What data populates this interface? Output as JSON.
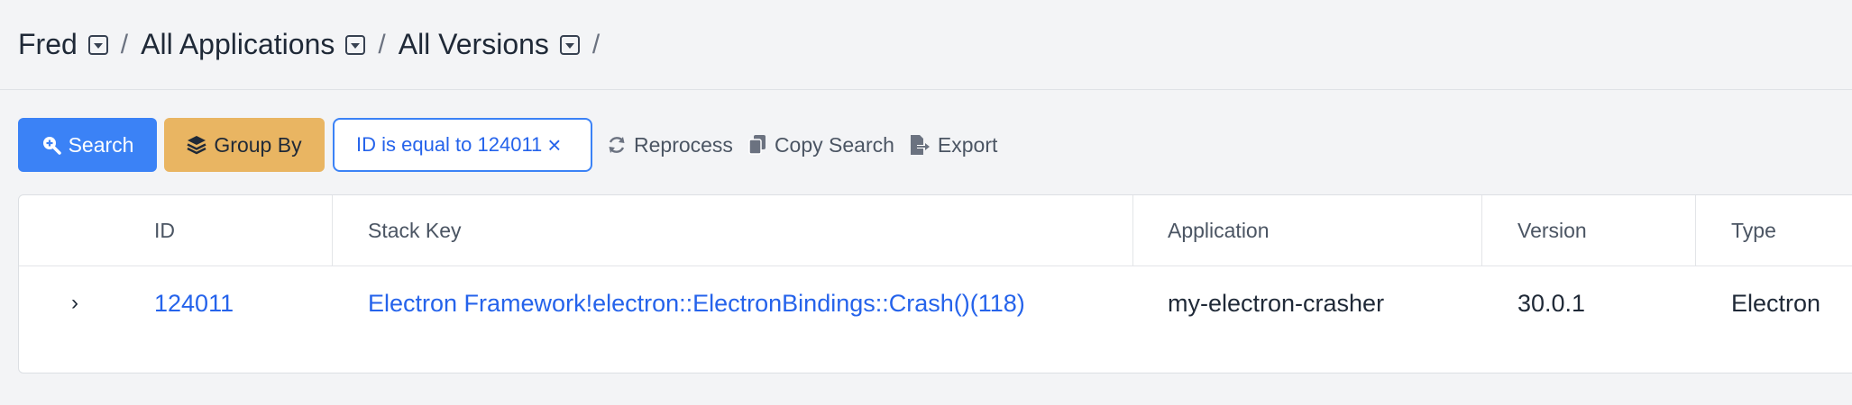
{
  "breadcrumb": [
    {
      "label": "Fred"
    },
    {
      "label": "All Applications"
    },
    {
      "label": "All Versions"
    }
  ],
  "toolbar": {
    "search_label": "Search",
    "group_by_label": "Group By",
    "filter_label": "ID is equal to 124011",
    "filter_close": "×",
    "reprocess_label": "Reprocess",
    "copy_search_label": "Copy Search",
    "export_label": "Export"
  },
  "table": {
    "columns": [
      "ID",
      "Stack Key",
      "Application",
      "Version",
      "Type"
    ],
    "rows": [
      {
        "expander": "›",
        "id": "124011",
        "stack_key": "Electron Framework!electron::ElectronBindings::Crash()(118)",
        "application": "my-electron-crasher",
        "version": "30.0.1",
        "type": "Electron"
      }
    ]
  },
  "colors": {
    "primary": "#3b82f6",
    "group_by": "#e9b562",
    "link": "#2563eb",
    "background": "#f3f4f6"
  }
}
